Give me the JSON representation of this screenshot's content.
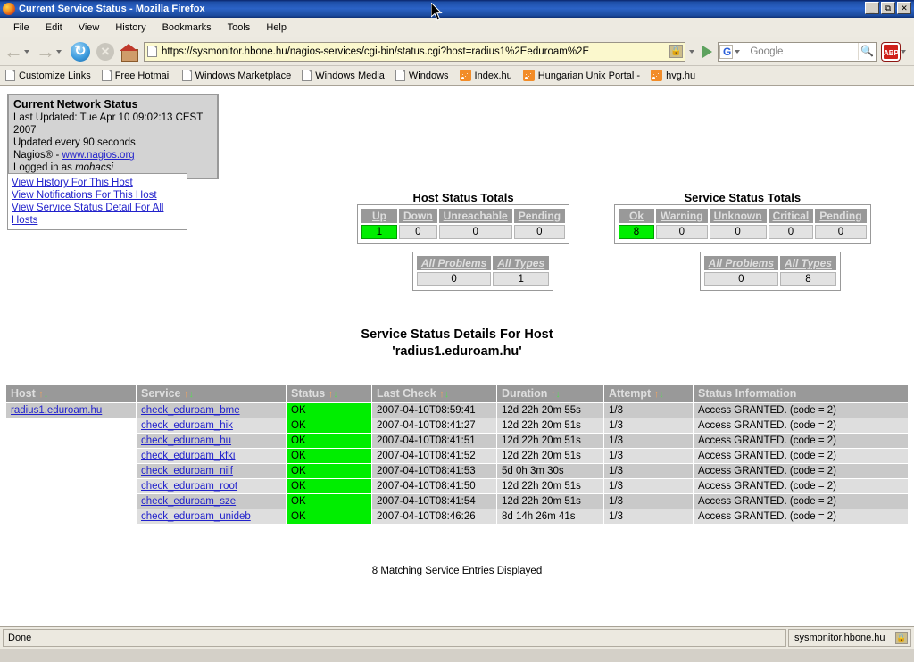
{
  "window": {
    "title": "Current Service Status - Mozilla Firefox",
    "minimize_label": "_",
    "restore_label": "❐",
    "close_label": "×"
  },
  "menu": {
    "items": [
      "File",
      "Edit",
      "View",
      "History",
      "Bookmarks",
      "Tools",
      "Help"
    ]
  },
  "navbar": {
    "url": "https://sysmonitor.hbone.hu/nagios-services/cgi-bin/status.cgi?host=radius1%2Eeduroam%2E",
    "search_placeholder": "Google",
    "search_engine": "Google",
    "abp_label": "ABP"
  },
  "bookmarks": {
    "items": [
      {
        "label": "Customize Links",
        "icon": "page-icon"
      },
      {
        "label": "Free Hotmail",
        "icon": "page-icon"
      },
      {
        "label": "Windows Marketplace",
        "icon": "page-icon"
      },
      {
        "label": "Windows Media",
        "icon": "page-icon"
      },
      {
        "label": "Windows",
        "icon": "page-icon"
      },
      {
        "label": "Index.hu",
        "icon": "rss-icon"
      },
      {
        "label": "Hungarian Unix Portal -",
        "icon": "rss-icon"
      },
      {
        "label": "hvg.hu",
        "icon": "rss-icon"
      }
    ]
  },
  "status_box": {
    "heading": "Current Network Status",
    "last_updated": "Last Updated: Tue Apr 10 09:02:13 CEST 2007",
    "update_interval": "Updated every 90 seconds",
    "nagios_prefix": "Nagios® - ",
    "nagios_link": "www.nagios.org",
    "logged_in_prefix": "Logged in as ",
    "logged_in_user": "mohacsi"
  },
  "nav_links": {
    "items": [
      "View History For This Host",
      "View Notifications For This Host",
      "View Service Status Detail For All Hosts"
    ]
  },
  "host_totals": {
    "title": "Host Status Totals",
    "headers": [
      "Up",
      "Down",
      "Unreachable",
      "Pending"
    ],
    "values": [
      "1",
      "0",
      "0",
      "0"
    ],
    "sub_headers": [
      "All Problems",
      "All Types"
    ],
    "sub_values": [
      "0",
      "1"
    ]
  },
  "service_totals": {
    "title": "Service Status Totals",
    "headers": [
      "Ok",
      "Warning",
      "Unknown",
      "Critical",
      "Pending"
    ],
    "values": [
      "8",
      "0",
      "0",
      "0",
      "0"
    ],
    "sub_headers": [
      "All Problems",
      "All Types"
    ],
    "sub_values": [
      "0",
      "8"
    ]
  },
  "page_heading": {
    "line1": "Service Status Details For Host",
    "line2": "'radius1.eduroam.hu'"
  },
  "service_table": {
    "columns": [
      {
        "label": "Host",
        "sortable": true
      },
      {
        "label": "Service",
        "sortable": true
      },
      {
        "label": "Status",
        "sortable": true
      },
      {
        "label": "Last Check",
        "sortable": true
      },
      {
        "label": "Duration",
        "sortable": true
      },
      {
        "label": "Attempt",
        "sortable": true
      },
      {
        "label": "Status Information",
        "sortable": false
      }
    ],
    "sort_up_glyph": "↑",
    "sort_down_glyph": "↓",
    "host_name": "radius1.eduroam.hu",
    "rows": [
      {
        "host": "radius1.eduroam.hu",
        "service": "check_eduroam_bme",
        "status": "OK",
        "last_check": "2007-04-10T08:59:41",
        "duration": "12d 22h 20m 55s",
        "attempt": "1/3",
        "info": "Access GRANTED. (code = 2)"
      },
      {
        "host": "",
        "service": "check_eduroam_hik",
        "status": "OK",
        "last_check": "2007-04-10T08:41:27",
        "duration": "12d 22h 20m 51s",
        "attempt": "1/3",
        "info": "Access GRANTED. (code = 2)"
      },
      {
        "host": "",
        "service": "check_eduroam_hu",
        "status": "OK",
        "last_check": "2007-04-10T08:41:51",
        "duration": "12d 22h 20m 51s",
        "attempt": "1/3",
        "info": "Access GRANTED. (code = 2)"
      },
      {
        "host": "",
        "service": "check_eduroam_kfki",
        "status": "OK",
        "last_check": "2007-04-10T08:41:52",
        "duration": "12d 22h 20m 51s",
        "attempt": "1/3",
        "info": "Access GRANTED. (code = 2)"
      },
      {
        "host": "",
        "service": "check_eduroam_niif",
        "status": "OK",
        "last_check": "2007-04-10T08:41:53",
        "duration": "5d 0h 3m 30s",
        "attempt": "1/3",
        "info": "Access GRANTED. (code = 2)"
      },
      {
        "host": "",
        "service": "check_eduroam_root",
        "status": "OK",
        "last_check": "2007-04-10T08:41:50",
        "duration": "12d 22h 20m 51s",
        "attempt": "1/3",
        "info": "Access GRANTED. (code = 2)"
      },
      {
        "host": "",
        "service": "check_eduroam_sze",
        "status": "OK",
        "last_check": "2007-04-10T08:41:54",
        "duration": "12d 22h 20m 51s",
        "attempt": "1/3",
        "info": "Access GRANTED. (code = 2)"
      },
      {
        "host": "",
        "service": "check_eduroam_unideb",
        "status": "OK",
        "last_check": "2007-04-10T08:46:26",
        "duration": "8d 14h 26m 41s",
        "attempt": "1/3",
        "info": "Access GRANTED. (code = 2)"
      }
    ],
    "footer": "8 Matching Service Entries Displayed"
  },
  "statusbar": {
    "message": "Done",
    "host": "sysmonitor.hbone.hu"
  },
  "colors": {
    "ok_green": "#00ee00",
    "header_gray": "#999999",
    "row_odd": "#c9c9c9",
    "row_even": "#dedede",
    "link_blue": "#2222cc",
    "titlebar_blue": "#1e4fa8"
  }
}
